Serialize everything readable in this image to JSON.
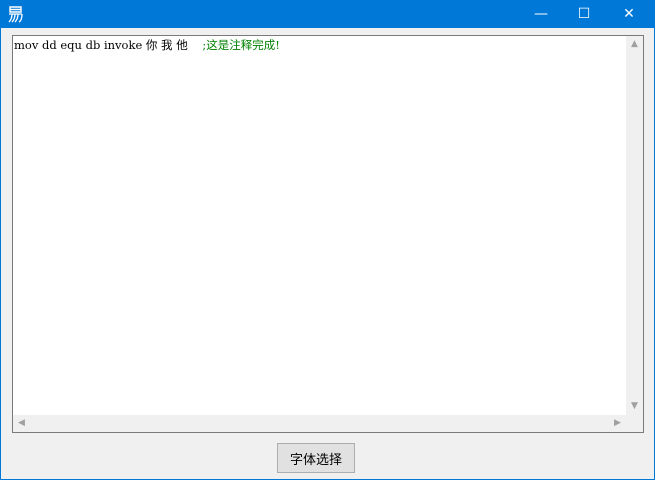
{
  "window": {
    "title": "",
    "icon": "yi-char-icon",
    "accent": "#0078d7",
    "controls": {
      "minimize": "—",
      "maximize": "☐",
      "close": "✕"
    }
  },
  "editor": {
    "code_text": "mov dd equ db invoke 你 我 他    ",
    "comment_text": ";这是注释完成!",
    "comment_color": "#008000",
    "scroll": {
      "up": "▲",
      "down": "▼",
      "left": "◀",
      "right": "▶"
    }
  },
  "button": {
    "label": "字体选择"
  }
}
